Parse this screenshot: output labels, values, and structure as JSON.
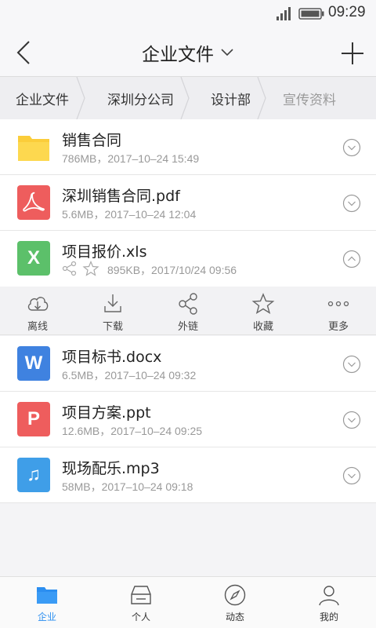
{
  "status_bar": {
    "time": "09:29"
  },
  "header": {
    "title": "企业文件"
  },
  "breadcrumb": [
    "企业文件",
    "深圳分公司",
    "设计部",
    "宣传资料"
  ],
  "files": [
    {
      "name": "销售合同",
      "meta": "786MB，2017–10–24  15:49",
      "icon": "folder-icon",
      "color": "#fbcd3a",
      "expanded": false
    },
    {
      "name": "深圳销售合同.pdf",
      "meta": "5.6MB，2017–10–24  12:04",
      "icon": "pdf-icon",
      "color": "#ee5d5d",
      "expanded": false
    },
    {
      "name": "项目报价.xls",
      "meta": "895KB，2017/10/24 09:56",
      "icon": "excel-icon",
      "glyph": "X",
      "color": "#5cc06a",
      "expanded": true
    },
    {
      "name": "项目标书.docx",
      "meta": "6.5MB，2017–10–24  09:32",
      "icon": "word-icon",
      "glyph": "W",
      "color": "#3f82e0",
      "expanded": false
    },
    {
      "name": "项目方案.ppt",
      "meta": "12.6MB，2017–10–24  09:25",
      "icon": "ppt-icon",
      "glyph": "P",
      "color": "#ee5d5d",
      "expanded": false
    },
    {
      "name": "现场配乐.mp3",
      "meta": "58MB，2017–10–24  09:18",
      "icon": "music-icon",
      "glyph": "♫",
      "color": "#3f9ee8",
      "expanded": false
    }
  ],
  "actions": [
    {
      "label": "离线",
      "icon": "cloud-download-icon"
    },
    {
      "label": "下载",
      "icon": "download-icon"
    },
    {
      "label": "外链",
      "icon": "share-icon"
    },
    {
      "label": "收藏",
      "icon": "star-icon"
    },
    {
      "label": "更多",
      "icon": "more-icon"
    }
  ],
  "tabs": [
    {
      "label": "企业",
      "icon": "folder-icon",
      "active": true
    },
    {
      "label": "个人",
      "icon": "drive-icon",
      "active": false
    },
    {
      "label": "动态",
      "icon": "compass-icon",
      "active": false
    },
    {
      "label": "我的",
      "icon": "person-icon",
      "active": false
    }
  ],
  "colors": {
    "accent": "#2b8ef0",
    "toggle": "#9a9a9a"
  }
}
